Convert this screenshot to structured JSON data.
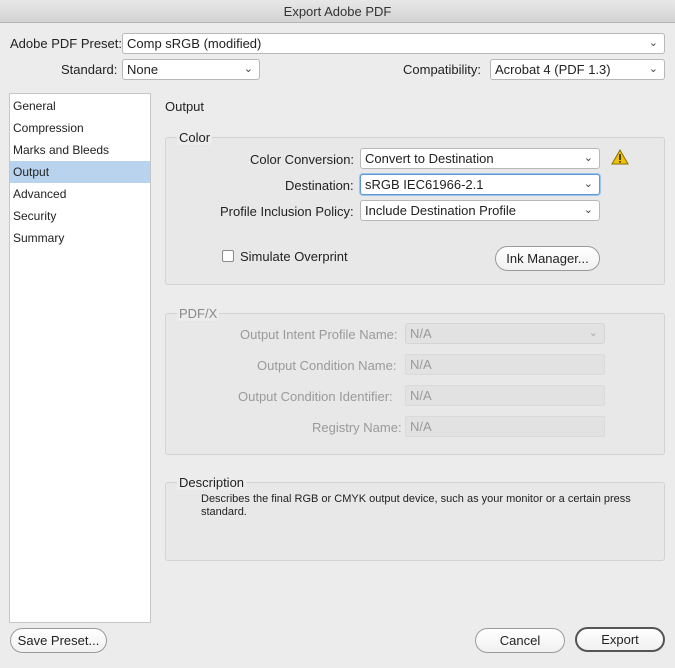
{
  "window": {
    "title": "Export Adobe PDF"
  },
  "header": {
    "preset_label": "Adobe PDF Preset:",
    "preset_value": "Comp sRGB (modified)",
    "standard_label": "Standard:",
    "standard_value": "None",
    "compat_label": "Compatibility:",
    "compat_value": "Acrobat 4 (PDF 1.3)"
  },
  "sidebar": {
    "items": [
      {
        "label": "General"
      },
      {
        "label": "Compression"
      },
      {
        "label": "Marks and Bleeds"
      },
      {
        "label": "Output"
      },
      {
        "label": "Advanced"
      },
      {
        "label": "Security"
      },
      {
        "label": "Summary"
      }
    ],
    "active": "Output"
  },
  "main": {
    "section_title": "Output",
    "color": {
      "title": "Color",
      "conversion_label": "Color Conversion:",
      "conversion_value": "Convert to Destination",
      "destination_label": "Destination:",
      "destination_value": "sRGB IEC61966-2.1",
      "policy_label": "Profile Inclusion Policy:",
      "policy_value": "Include Destination Profile",
      "simulate_label": "Simulate Overprint",
      "ink_button": "Ink Manager..."
    },
    "pdfx": {
      "title": "PDF/X",
      "intent_label": "Output Intent Profile Name:",
      "intent_value": "N/A",
      "condition_name_label": "Output Condition Name:",
      "condition_name_value": "N/A",
      "condition_id_label": "Output Condition Identifier:",
      "condition_id_value": "N/A",
      "registry_label": "Registry Name:",
      "registry_value": "N/A"
    },
    "description": {
      "title": "Description",
      "text": "Describes the final RGB or CMYK output device, such as your monitor or a certain press standard."
    }
  },
  "footer": {
    "save_preset": "Save Preset...",
    "cancel": "Cancel",
    "export": "Export"
  },
  "colors": {
    "selection": "#b9d3ee",
    "warning": "#f2c200",
    "focus": "#5b9bd5"
  }
}
